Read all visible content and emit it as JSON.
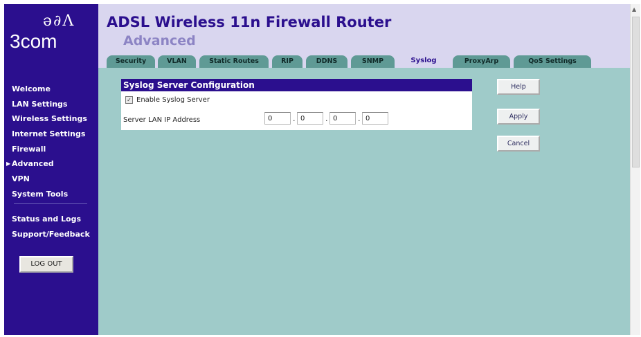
{
  "brand": {
    "mark": "ə∂Ʌ",
    "logo_text": "3com"
  },
  "header": {
    "title": "ADSL Wireless 11n Firewall Router",
    "subtitle": "Advanced"
  },
  "tabs": [
    {
      "label": "Security",
      "active": false
    },
    {
      "label": "VLAN",
      "active": false
    },
    {
      "label": "Static Routes",
      "active": false
    },
    {
      "label": "RIP",
      "active": false
    },
    {
      "label": "DDNS",
      "active": false
    },
    {
      "label": "SNMP",
      "active": false
    },
    {
      "label": "Syslog",
      "active": true
    },
    {
      "label": "ProxyArp",
      "active": false
    },
    {
      "label": "QoS Settings",
      "active": false
    }
  ],
  "sidebar": {
    "items": [
      {
        "label": "Welcome"
      },
      {
        "label": "LAN Settings"
      },
      {
        "label": "Wireless Settings"
      },
      {
        "label": "Internet Settings"
      },
      {
        "label": "Firewall"
      },
      {
        "label": "Advanced",
        "active": true,
        "marker": "▶"
      },
      {
        "label": "VPN"
      },
      {
        "label": "System Tools"
      }
    ],
    "secondary_items": [
      {
        "label": "Status and Logs"
      },
      {
        "label": "Support/Feedback"
      }
    ],
    "logout_label": "LOG OUT"
  },
  "syslog_panel": {
    "title": "Syslog Server Configuration",
    "enable_label": "Enable Syslog Server",
    "enable_checked": true,
    "check_mark": "✓",
    "ip_label": "Server LAN IP Address",
    "ip_octets": [
      "0",
      "0",
      "0",
      "0"
    ],
    "ip_separator": "."
  },
  "buttons": {
    "help": "Help",
    "apply": "Apply",
    "cancel": "Cancel"
  },
  "scrollbar": {
    "up_arrow": "▲"
  },
  "colors": {
    "navy": "#2b0f8e",
    "teal_content": "#9fcbc9",
    "tab_teal": "#5f9a95",
    "header_bg": "#d9d6ef"
  }
}
